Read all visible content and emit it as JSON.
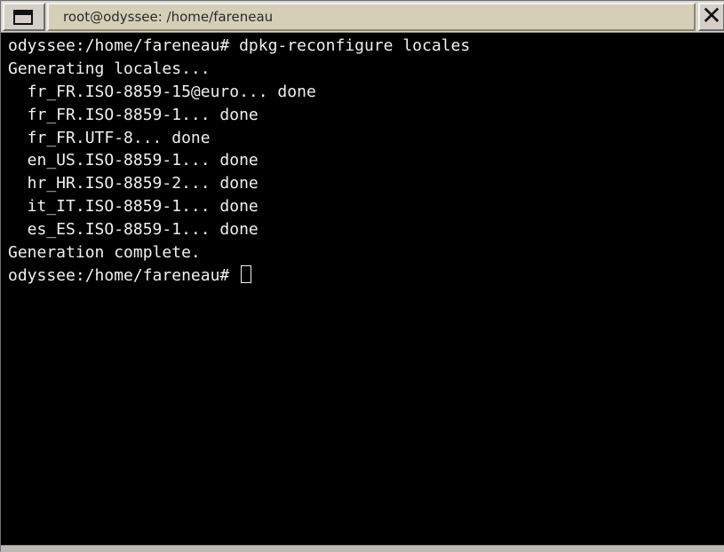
{
  "window": {
    "title": "root@odyssee: /home/fareneau"
  },
  "icons": {
    "menu": "window-menu-icon",
    "close": "close-icon",
    "close_glyph": "✕"
  },
  "terminal": {
    "lines": [
      "odyssee:/home/fareneau# dpkg-reconfigure locales",
      "Generating locales...",
      "  fr_FR.ISO-8859-15@euro... done",
      "  fr_FR.ISO-8859-1... done",
      "  fr_FR.UTF-8... done",
      "  en_US.ISO-8859-1... done",
      "  hr_HR.ISO-8859-2... done",
      "  it_IT.ISO-8859-1... done",
      "  es_ES.ISO-8859-1... done",
      "Generation complete."
    ],
    "prompt": "odyssee:/home/fareneau# "
  },
  "colors": {
    "terminal_bg": "#000000",
    "terminal_fg": "#f0f0f0",
    "titlebar_bg": "#d6cfb7"
  }
}
